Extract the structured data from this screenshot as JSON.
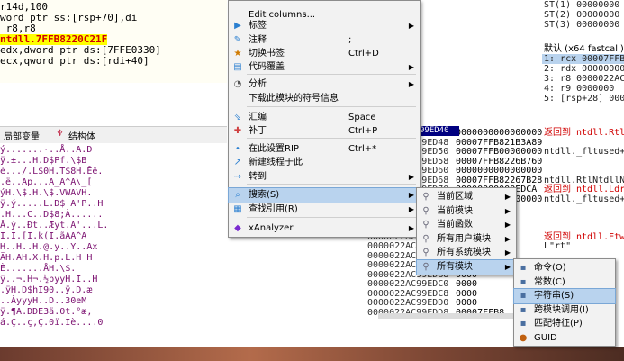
{
  "disasm": {
    "lines": [
      "r14d,100",
      "word ptr ss:[rsp+70],di",
      " r8,r8",
      "ntdll.7FFB8220C21F",
      "edx,dword ptr ds:[7FFE0330]",
      "ecx,qword ptr ds:[rdi+40]"
    ]
  },
  "registers": {
    "top_lines": [
      "ST(1) 00000000",
      "ST(2) 00000000",
      "ST(3) 00000000"
    ],
    "convention_label": "默认 (x64 fastcall)",
    "args": [
      "1: rcx 00007FFB8",
      "2: rdx 00000000",
      "3: r8 0000022AC",
      "4: r9 0000000",
      "5: [rsp+28] 000"
    ]
  },
  "tabs": {
    "locals": "局部变量",
    "struct": "结构体"
  },
  "dump": {
    "lines": [
      "ý.......·..Å..A.D",
      "ÿ.±...H.D$Pf.\\$B",
      "é.../.L$0H.T$8H.Êë.",
      ".ë..Ap...A_A^A\\_[",
      "ýH.\\$.H.\\$.VWAVH.",
      "ÿ.ý.....L.D$ A'P..H",
      ".H...C..D$8;À......",
      "Â.ý..Ðt..Æyt.A'...L.",
      "I.I.[I.k(I.ãAA^A",
      "H..H..H.@.y..Y..Ax",
      "ÄH.AH.X.H.p.L.H H",
      "È.......ÅH.\\$.",
      "ÿ..¬.H¬.½þyyH.I..H",
      ".ÿH.D$hI90..ÿ.D.æ",
      "..ÀyyyH..D..30eM",
      "ÿ.¶A.DÐE3ä.0t.°æ,",
      "á.Ç..ç,Ç.0ï.Iè....0"
    ]
  },
  "stack": {
    "rows": [
      {
        "addr": "0000022AC99ED40",
        "val": "0000000000000000",
        "cmt": "返回到 ntdll.RtlG",
        "red": true
      },
      {
        "addr": "0000022AC99ED48",
        "val": "00007FFB821B3A89",
        "cmt": "",
        "red": false
      },
      {
        "addr": "0000022AC99ED50",
        "val": "00007FFB00000000",
        "cmt": "ntdll._fltused+2",
        "red": false
      },
      {
        "addr": "0000022AC99ED58",
        "val": "00007FFB8226B760",
        "cmt": "",
        "red": false
      },
      {
        "addr": "0000022AC99ED60",
        "val": "0000000000000000",
        "cmt": "",
        "red": false
      },
      {
        "addr": "0000022AC99ED68",
        "val": "00007FFB82267B28",
        "cmt": "ntdll.RtlNtdllNa",
        "red": false
      },
      {
        "addr": "0000022AC99ED70",
        "val": "00000000000EDCA",
        "cmt": "返回到 ntdll.LdrI",
        "red": true
      },
      {
        "addr": "0000022AC99ED78",
        "val": "00007FFB00000000",
        "cmt": "ntdll._fltused+2",
        "red": false
      },
      {
        "addr": "0000022AC99ED80",
        "val": "",
        "cmt": "",
        "red": false
      },
      {
        "addr": "0000022AC99ED88",
        "val": "",
        "cmt": "",
        "red": false
      },
      {
        "addr": "0000022AC99ED90",
        "val": "",
        "cmt": "",
        "red": false
      },
      {
        "addr": "0000022AC99ED98",
        "val": "AB16",
        "cmt": "返回到 ntdll.EtwL",
        "red": true
      },
      {
        "addr": "0000022AC99EDA0",
        "val": "6728",
        "cmt": "L\"rt\"",
        "red": false
      },
      {
        "addr": "0000022AC99EDA8",
        "val": "F8B",
        "cmt": "",
        "red": false
      },
      {
        "addr": "0000022AC99EDB0",
        "val": "0000",
        "cmt": "",
        "red": false
      },
      {
        "addr": "0000022AC99EDB8",
        "val": "0000",
        "cmt": "",
        "red": false
      },
      {
        "addr": "0000022AC99EDC0",
        "val": "0000",
        "cmt": "",
        "red": false
      },
      {
        "addr": "0000022AC99EDC8",
        "val": "0000",
        "cmt": "",
        "red": false
      },
      {
        "addr": "0000022AC99EDD0",
        "val": "0000",
        "cmt": "",
        "red": false
      },
      {
        "addr": "0000022AC99EDD8",
        "val": "00007FFB8",
        "cmt": "",
        "red": false
      }
    ],
    "highlight": "99ED40"
  },
  "menu_main": {
    "items": [
      {
        "icon": "",
        "label": "",
        "shortcut": "",
        "arrow": ""
      },
      {
        "icon": "",
        "label": "Edit columns...",
        "shortcut": "",
        "arrow": ""
      },
      {
        "icon": "▶",
        "label": "标签",
        "shortcut": "",
        "arrow": "▶"
      },
      {
        "icon": "✎",
        "label": "注释",
        "shortcut": ";",
        "arrow": ""
      },
      {
        "icon": "★",
        "label": "切换书签",
        "shortcut": "Ctrl+D",
        "arrow": ""
      },
      {
        "icon": "▤",
        "label": "代码覆盖",
        "shortcut": "",
        "arrow": "▶"
      },
      {
        "icon": "◔",
        "label": "分析",
        "shortcut": "",
        "arrow": "▶"
      },
      {
        "icon": "",
        "label": "下载此模块的符号信息",
        "shortcut": "",
        "arrow": ""
      },
      {
        "icon": "⇘",
        "label": "汇编",
        "shortcut": "Space",
        "arrow": ""
      },
      {
        "icon": "✚",
        "label": "补丁",
        "shortcut": "Ctrl+P",
        "arrow": ""
      },
      {
        "icon": "•",
        "label": "在此设置RIP",
        "shortcut": "Ctrl+*",
        "arrow": ""
      },
      {
        "icon": "↗",
        "label": "新建线程于此",
        "shortcut": "",
        "arrow": ""
      },
      {
        "icon": "⇢",
        "label": "转到",
        "shortcut": "",
        "arrow": "▶"
      },
      {
        "icon": "⌕",
        "label": "搜索(S)",
        "shortcut": "",
        "arrow": "▶"
      },
      {
        "icon": "▦",
        "label": "查找引用(R)",
        "shortcut": "",
        "arrow": "▶"
      },
      {
        "icon": "◆",
        "label": "xAnalyzer",
        "shortcut": "",
        "arrow": "▶"
      }
    ]
  },
  "menu_search": {
    "items": [
      {
        "label": "当前区域",
        "arrow": "▶"
      },
      {
        "label": "当前模块",
        "arrow": "▶"
      },
      {
        "label": "当前函数",
        "arrow": "▶"
      },
      {
        "label": "所有用户模块",
        "arrow": "▶"
      },
      {
        "label": "所有系统模块",
        "arrow": "▶"
      },
      {
        "label": "所有模块",
        "arrow": "▶"
      }
    ]
  },
  "menu_allmods": {
    "items": [
      {
        "icon": "▪",
        "label": "命令(O)"
      },
      {
        "icon": "▪",
        "label": "常数(C)"
      },
      {
        "icon": "▪",
        "label": "字符串(S)"
      },
      {
        "icon": "▪",
        "label": "跨模块调用(I)"
      },
      {
        "icon": "▪",
        "label": "匹配特征(P)"
      },
      {
        "icon": "●",
        "label": "GUID"
      }
    ]
  },
  "colors": {
    "accent_selection": "#b9d3ee",
    "highlight_yellow": "#ffff00",
    "return_red": "#d00000"
  }
}
